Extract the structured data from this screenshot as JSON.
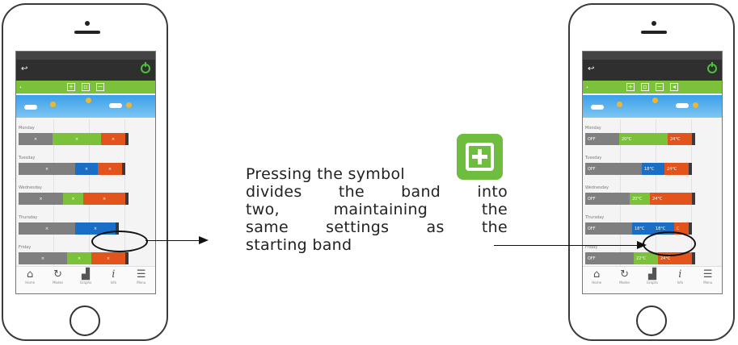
{
  "caption": {
    "line1": "Pressing the symbol",
    "line2": "divides the band into",
    "line3": "two, maintaining the",
    "line4": "same settings as the",
    "line5": "starting band"
  },
  "icons": {
    "plus": "plus-square-icon",
    "back": "back-arrow-icon",
    "power": "power-icon"
  },
  "colors": {
    "green": "#7cc13a",
    "orange": "#e2541b",
    "blue": "#1b6ec5",
    "grey": "#7f7f7f",
    "topbar": "#2f2f2f"
  },
  "left_phone": {
    "days": [
      {
        "label": "Monday",
        "segments": [
          {
            "color": "grey",
            "text": "×"
          },
          {
            "color": "green",
            "text": "×"
          },
          {
            "color": "orange",
            "text": "×"
          }
        ]
      },
      {
        "label": "Tuesday",
        "segments": [
          {
            "color": "grey",
            "text": "×"
          },
          {
            "color": "blue",
            "text": "×"
          },
          {
            "color": "orange",
            "text": "×"
          }
        ]
      },
      {
        "label": "Wednesday",
        "segments": [
          {
            "color": "grey",
            "text": "×"
          },
          {
            "color": "green",
            "text": "×"
          },
          {
            "color": "orange",
            "text": "×"
          }
        ]
      },
      {
        "label": "Thursday",
        "segments": [
          {
            "color": "grey",
            "text": "×"
          },
          {
            "color": "blue",
            "text": "×"
          }
        ]
      },
      {
        "label": "Friday",
        "segments": [
          {
            "color": "grey",
            "text": "×"
          },
          {
            "color": "green",
            "text": "×"
          },
          {
            "color": "orange",
            "text": "×"
          }
        ]
      }
    ]
  },
  "right_phone": {
    "days": [
      {
        "label": "Monday",
        "segments": [
          {
            "color": "grey",
            "text": "OFF"
          },
          {
            "color": "green",
            "text": "20°C"
          },
          {
            "color": "orange",
            "text": "24°C"
          }
        ]
      },
      {
        "label": "Tuesday",
        "segments": [
          {
            "color": "grey",
            "text": "OFF"
          },
          {
            "color": "blue",
            "text": "18°C"
          },
          {
            "color": "orange",
            "text": "24°C"
          }
        ]
      },
      {
        "label": "Wednesday",
        "segments": [
          {
            "color": "grey",
            "text": "OFF"
          },
          {
            "color": "green",
            "text": "20°C"
          },
          {
            "color": "orange",
            "text": "24°C"
          }
        ]
      },
      {
        "label": "Thursday",
        "segments": [
          {
            "color": "grey",
            "text": "OFF"
          },
          {
            "color": "blue",
            "text": "18°C"
          },
          {
            "color": "blue",
            "text": "18°C"
          },
          {
            "color": "orange",
            "text": "C"
          }
        ]
      },
      {
        "label": "Friday",
        "segments": [
          {
            "color": "grey",
            "text": "OFF"
          },
          {
            "color": "green",
            "text": "22°C"
          },
          {
            "color": "orange",
            "text": "24°C"
          }
        ]
      }
    ]
  },
  "nav": [
    "Home",
    "Modes",
    "Graphs",
    "Info",
    "Menu"
  ]
}
